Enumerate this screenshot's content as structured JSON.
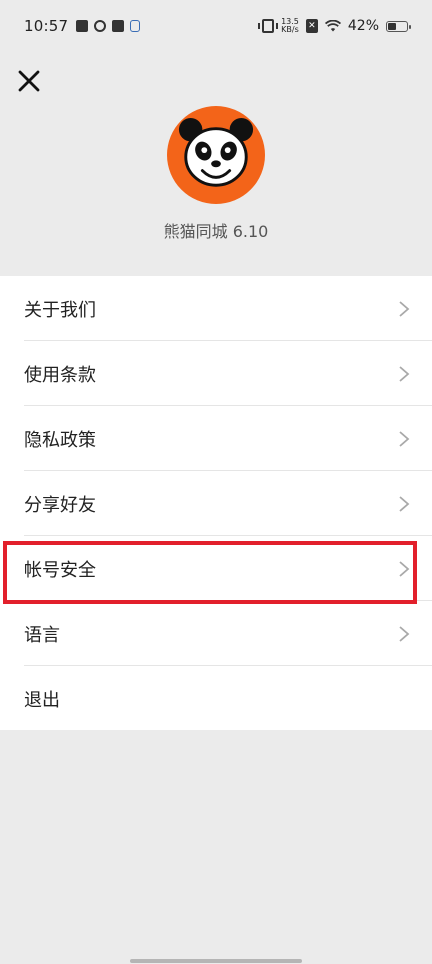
{
  "status_bar": {
    "time": "10:57",
    "net_speed_value": "13.5",
    "net_speed_unit": "KB/s",
    "battery_percent": "42%"
  },
  "header": {
    "app_name_version": "熊猫同城 6.10"
  },
  "menu": {
    "items": [
      {
        "label": "关于我们",
        "has_chevron": true
      },
      {
        "label": "使用条款",
        "has_chevron": true
      },
      {
        "label": "隐私政策",
        "has_chevron": true
      },
      {
        "label": "分享好友",
        "has_chevron": true
      },
      {
        "label": "帐号安全",
        "has_chevron": true
      },
      {
        "label": "语言",
        "has_chevron": true
      },
      {
        "label": "退出",
        "has_chevron": false
      }
    ]
  },
  "colors": {
    "background": "#ebebeb",
    "logo_orange": "#f36419",
    "highlight_red": "#e2202b",
    "chevron_gray": "#a9a9a9"
  },
  "icons": {
    "close": "close-icon",
    "chevron": "chevron-right-icon",
    "logo": "panda-logo"
  }
}
